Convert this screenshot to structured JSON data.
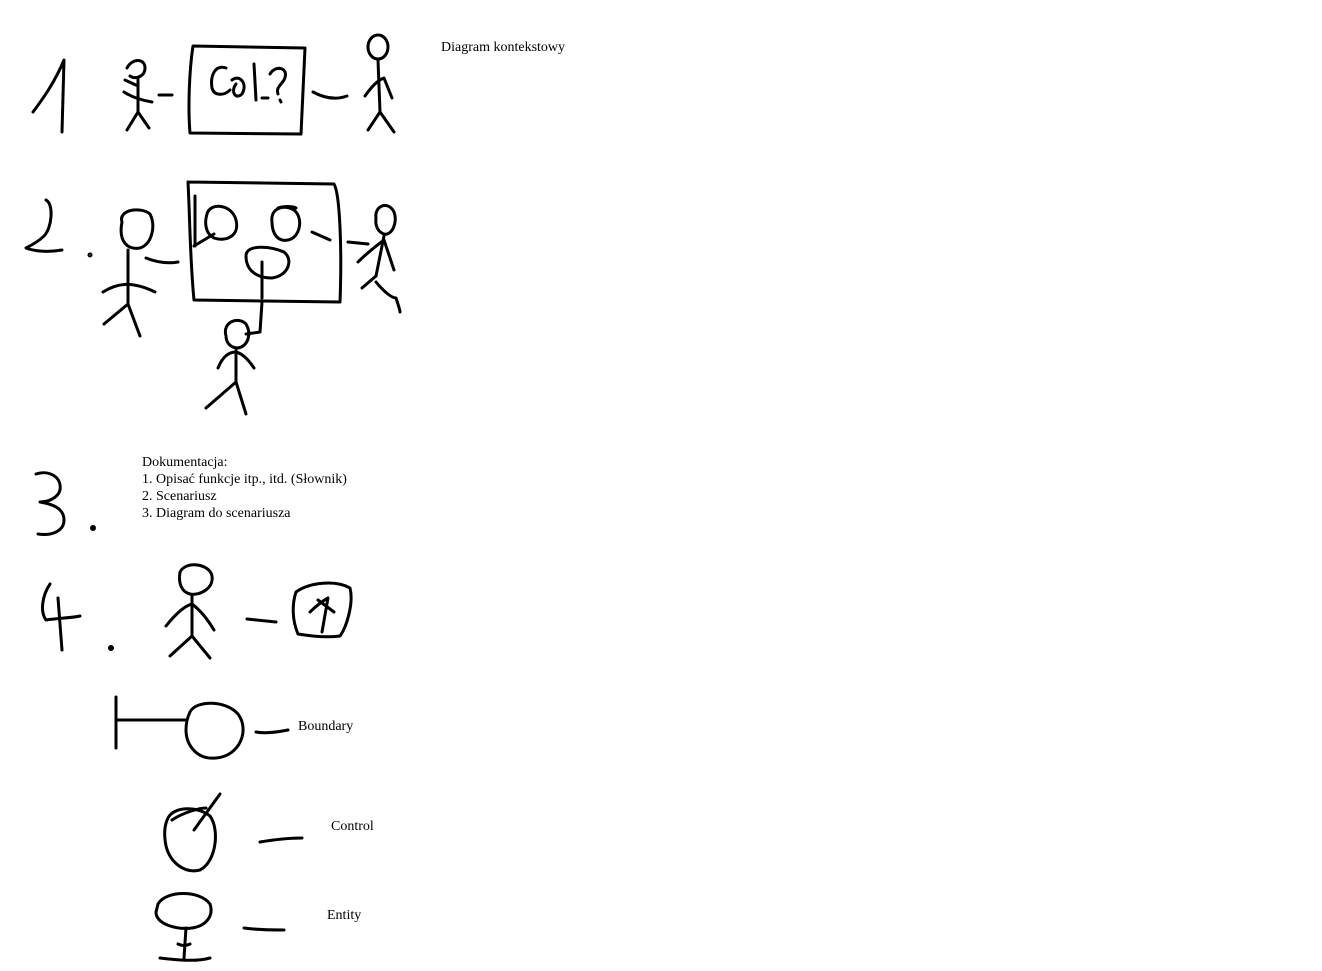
{
  "labels": {
    "context_diagram": "Diagram kontekstowy",
    "boundary": "Boundary",
    "control": "Control",
    "entity": "Entity"
  },
  "documentation": {
    "heading": "Dokumentacja:",
    "items": [
      "1. Opisać funkcje itp., itd. (Słownik)",
      "2. Scenariusz",
      "3. Diagram do scenariusza"
    ]
  },
  "colors": {
    "ink": "#000000",
    "background": "#ffffff"
  }
}
